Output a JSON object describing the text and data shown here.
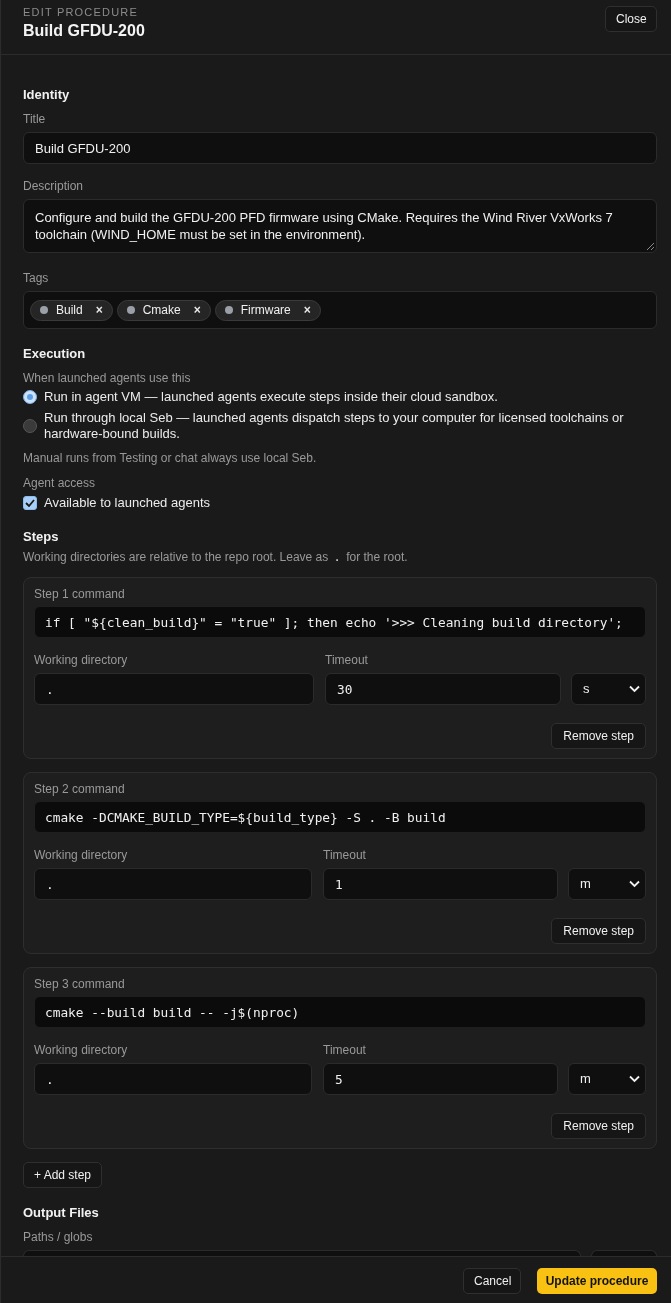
{
  "header": {
    "eyebrow": "EDIT PROCEDURE",
    "title": "Build GFDU-200",
    "close_button": "Close"
  },
  "identity": {
    "heading": "Identity",
    "title_label": "Title",
    "title_value": "Build GFDU-200",
    "description_label": "Description",
    "description_value": "Configure and build the GFDU-200 PFD firmware using CMake. Requires the Wind River VxWorks 7 toolchain (WIND_HOME must be set in the environment).",
    "tags_label": "Tags",
    "tags": [
      {
        "label": "Build",
        "remove_glyph": "×"
      },
      {
        "label": "Cmake",
        "remove_glyph": "×"
      },
      {
        "label": "Firmware",
        "remove_glyph": "×"
      }
    ]
  },
  "execution": {
    "heading": "Execution",
    "mode_label": "When launched agents use this",
    "modes": [
      {
        "label": "Run in agent VM — launched agents execute steps inside their cloud sandbox.",
        "selected": true
      },
      {
        "label": "Run through local Seb — launched agents dispatch steps to your computer for licensed toolchains or hardware-bound builds.",
        "selected": false
      }
    ],
    "note": "Manual runs from Testing or chat always use local Seb.",
    "access_label": "Agent access",
    "access_option": {
      "label": "Available to launched agents",
      "checked": true
    }
  },
  "steps": {
    "heading": "Steps",
    "hint_parts": [
      {
        "kind": "text",
        "text": "Working directories are relative to the repo root. Leave as "
      },
      {
        "kind": "code",
        "text": "."
      },
      {
        "kind": "text",
        "text": " for the root."
      }
    ],
    "items": [
      {
        "command_label": "Step 1 command",
        "command": "if [ \"${clean_build}\" = \"true\" ]; then echo '>>> Cleaning build directory';",
        "dir_label": "Working directory",
        "dir": ".",
        "timeout_label": "Timeout",
        "timeout": "30",
        "unit": "s",
        "remove_button": "Remove step"
      },
      {
        "command_label": "Step 2 command",
        "command": "cmake -DCMAKE_BUILD_TYPE=${build_type} -S . -B build",
        "dir_label": "Working directory",
        "dir": ".",
        "timeout_label": "Timeout",
        "timeout": "1",
        "unit": "m",
        "remove_button": "Remove step"
      },
      {
        "command_label": "Step 3 command",
        "command": "cmake --build build -- -j$(nproc)",
        "dir_label": "Working directory",
        "dir": ".",
        "timeout_label": "Timeout",
        "timeout": "5",
        "unit": "m",
        "remove_button": "Remove step"
      }
    ],
    "add_button": "+ Add step"
  },
  "output": {
    "heading": "Output Files",
    "paths_label": "Paths / globs"
  },
  "footer": {
    "cancel_button": "Cancel",
    "submit_button": "Update procedure"
  }
}
